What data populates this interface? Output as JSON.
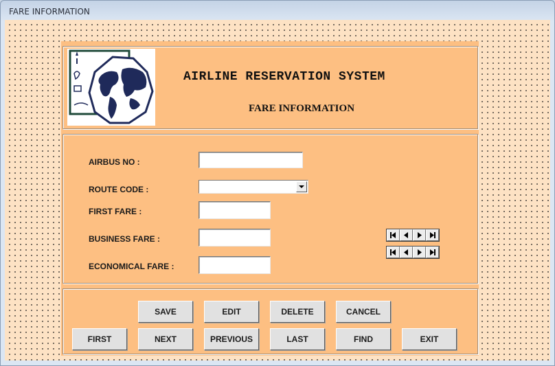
{
  "window": {
    "title": "FARE INFORMATION"
  },
  "header": {
    "logo_icon": "globe-travel-logo",
    "app_title": "AIRLINE RESERVATION SYSTEM",
    "sub_title": "FARE INFORMATION"
  },
  "form": {
    "airbus_no": {
      "label": "AIRBUS NO :",
      "value": ""
    },
    "route_code": {
      "label": "ROUTE CODE :",
      "value": ""
    },
    "first_fare": {
      "label": "FIRST FARE :",
      "value": ""
    },
    "business_fare": {
      "label": "BUSINESS FARE :",
      "value": ""
    },
    "economical_fare": {
      "label": "ECONOMICAL FARE :",
      "value": ""
    }
  },
  "record_navigators": [
    {
      "buttons": [
        "first-record",
        "previous-record",
        "next-record",
        "last-record"
      ]
    },
    {
      "buttons": [
        "first-record",
        "previous-record",
        "next-record",
        "last-record"
      ]
    }
  ],
  "buttons": {
    "save": "SAVE",
    "edit": "EDIT",
    "delete": "DELETE",
    "cancel": "CANCEL",
    "first": "FIRST",
    "next": "NEXT",
    "previous": "PREVIOUS",
    "last": "LAST",
    "find": "FIND",
    "exit": "EXIT"
  },
  "colors": {
    "panel": "#fdbf82",
    "background": "#fde2c4",
    "button": "#e1e1e1"
  }
}
